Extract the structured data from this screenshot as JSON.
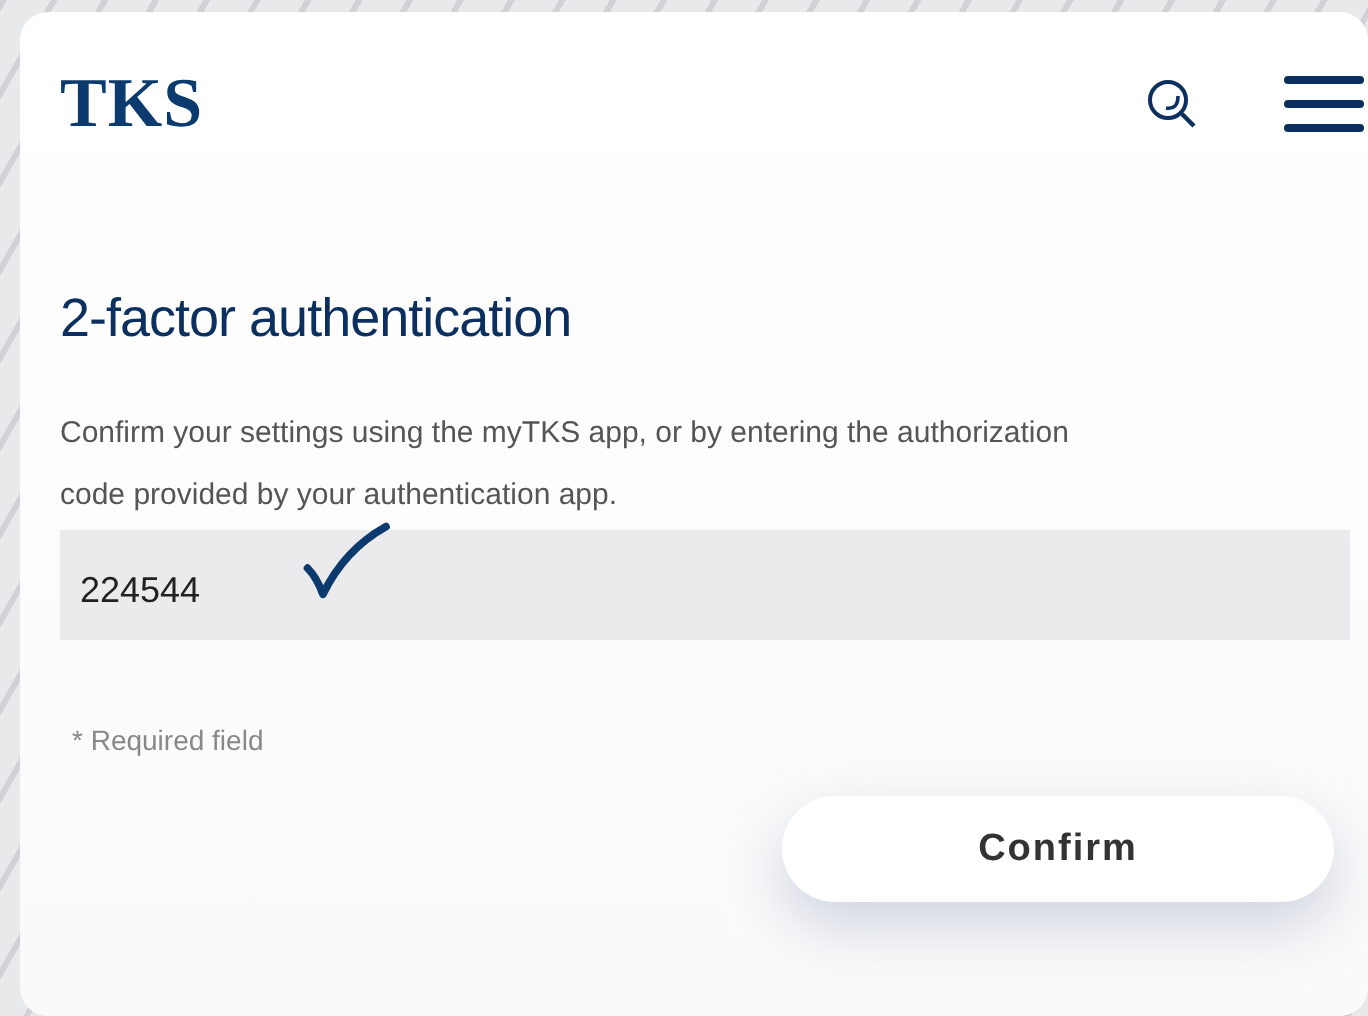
{
  "header": {
    "logo": "TKS"
  },
  "title": "2-factor authentication",
  "description": "Confirm your settings using the myTKS app, or by entering the authorization code provided by your authentication app.",
  "code_field": {
    "value": "224544",
    "verified": true
  },
  "required_note": "* Required field",
  "buttons": [
    "Confirm"
  ]
}
